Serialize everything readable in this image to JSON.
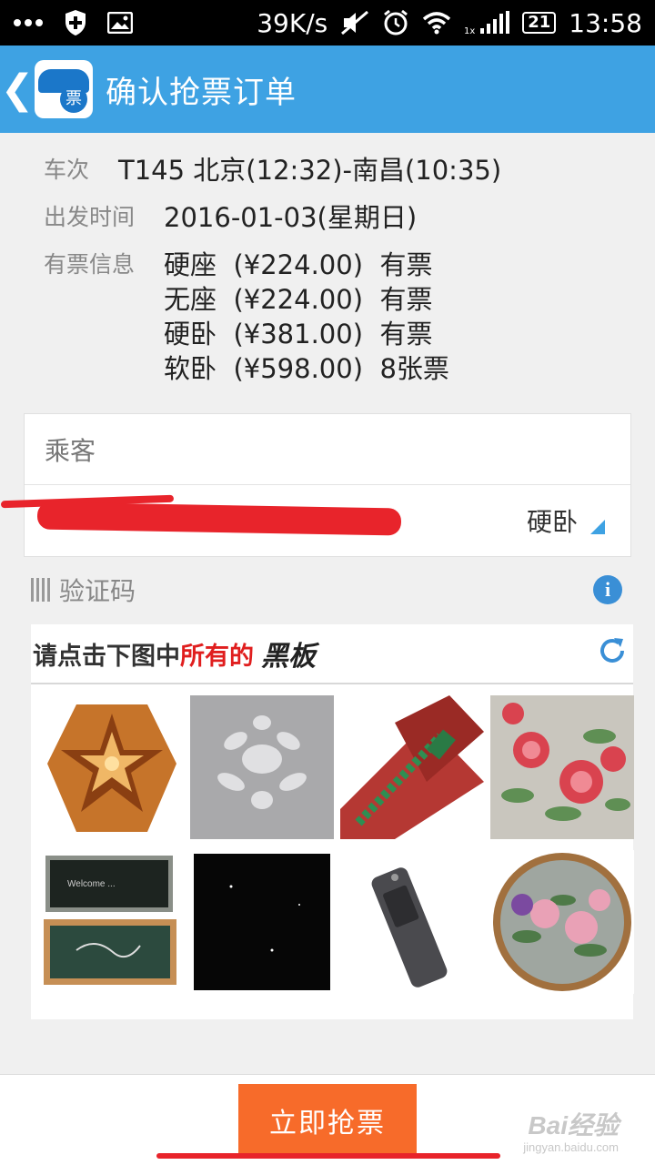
{
  "status_bar": {
    "left_icons": [
      "more-dots-icon",
      "shield-plus-icon",
      "image-icon"
    ],
    "net_speed": "39K/s",
    "battery_level": "21",
    "time": "13:58",
    "right_icons": [
      "mute-icon",
      "alarm-icon",
      "wifi-icon",
      "signal-icon"
    ]
  },
  "appbar": {
    "back_glyph": "❮",
    "logo_glyph": "票",
    "title": "确认抢票订单"
  },
  "train_info": {
    "train_label": "车次",
    "train_value": "T145 北京(12:32)-南昌(10:35)",
    "depart_label": "出发时间",
    "depart_value": "2016-01-03(星期日)",
    "tickets_label": "有票信息",
    "tickets": [
      {
        "seat": "硬座",
        "price": "(¥224.00)",
        "status": "有票"
      },
      {
        "seat": "无座",
        "price": "(¥224.00)",
        "status": "有票"
      },
      {
        "seat": "硬卧",
        "price": "(¥381.00)",
        "status": "有票"
      },
      {
        "seat": "软卧",
        "price": "(¥598.00)",
        "status": "8张票"
      }
    ]
  },
  "passenger": {
    "header": "乘客",
    "seat_type": "硬卧"
  },
  "captcha": {
    "label": "验证码",
    "info_glyph": "i",
    "prompt_a": "请点击下图中",
    "prompt_b": "所有的",
    "prompt_keyword": "黑板",
    "tiles": [
      "star-lantern",
      "white-embroidery",
      "zipper",
      "peony-embroidery",
      "chalkboards",
      "black-board",
      "usb-recorder",
      "embroidery-hoop"
    ]
  },
  "bottom": {
    "button_label": "立即抢票",
    "watermark": "Bai经验",
    "watermark_url": "jingyan.baidu.com"
  },
  "colors": {
    "accent": "#3ea2e3",
    "button": "#f76b2a",
    "redaction": "#e8242b",
    "prompt_red": "#e01e1e"
  }
}
